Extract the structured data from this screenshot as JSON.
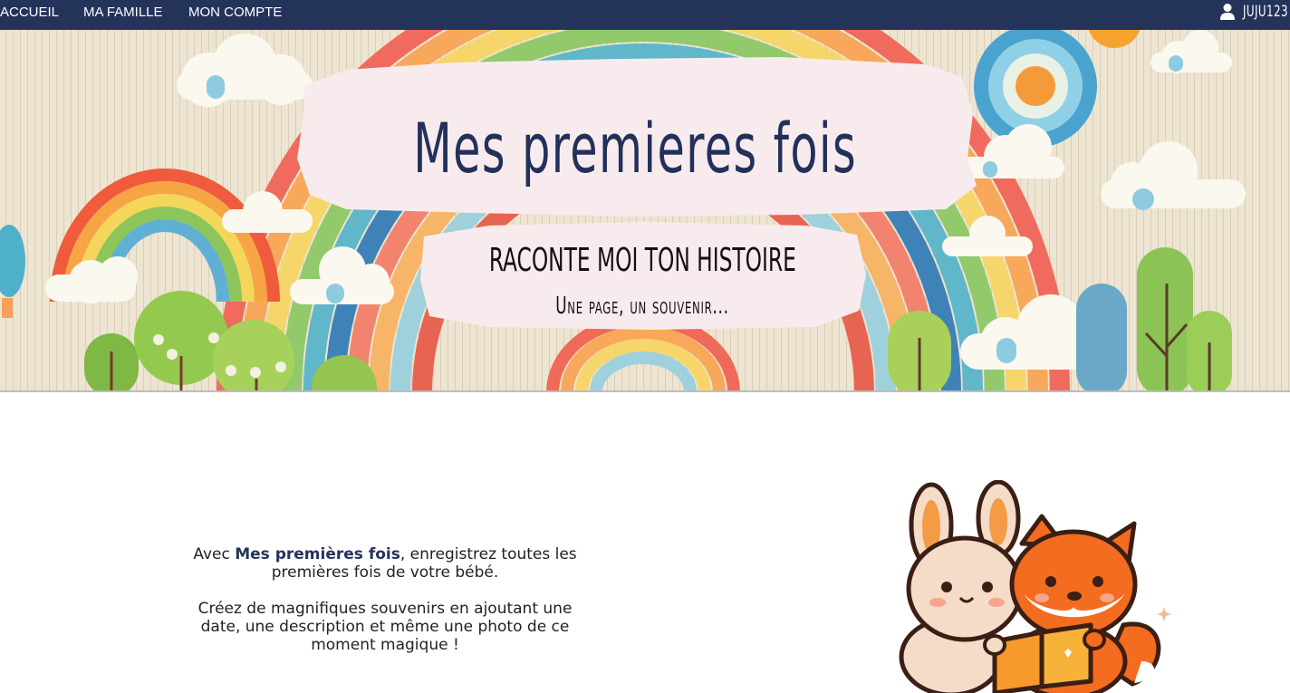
{
  "nav": {
    "links": [
      "ACCUEIL",
      "MA FAMILLE",
      "MON COMPTE"
    ],
    "user_icon": "user-icon",
    "username": "JUJU123"
  },
  "hero": {
    "title": "Mes premieres fois",
    "subtitle": "Raconte moi ton histoire",
    "tagline": "Une page, un souvenir..."
  },
  "intro": {
    "p1_before": "Avec ",
    "p1_brand": "Mes premières fois",
    "p1_after": ", enregistrez toutes les premières fois de votre bébé.",
    "p2": "Créez de magnifiques souvenirs en ajoutant une date, une description et même une photo de ce moment magique !"
  },
  "mascot": {
    "icon": "bunny-fox-reading-illustration"
  },
  "colors": {
    "navbar": "#24335a",
    "brand": "#24335a",
    "banner": "#f8ebee"
  }
}
